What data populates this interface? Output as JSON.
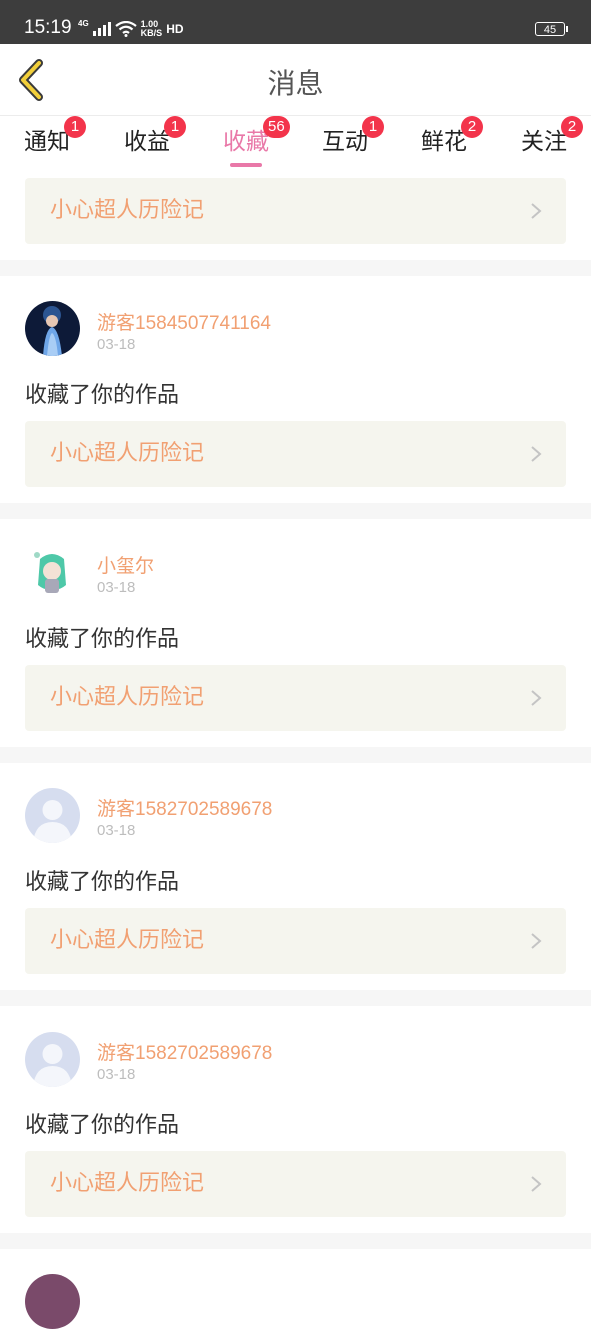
{
  "status_bar": {
    "time": "15:19",
    "network": "4G",
    "speed_value": "1.00",
    "speed_unit": "KB/S",
    "hd": "HD",
    "battery": "45"
  },
  "header": {
    "title": "消息",
    "back_icon": "chevron-left-icon"
  },
  "tabs": [
    {
      "label": "通知",
      "badge": "1",
      "active": false
    },
    {
      "label": "收益",
      "badge": "1",
      "active": false
    },
    {
      "label": "收藏",
      "badge": "56",
      "active": true
    },
    {
      "label": "互动",
      "badge": "1",
      "active": false
    },
    {
      "label": "鲜花",
      "badge": "2",
      "active": false
    },
    {
      "label": "关注",
      "badge": "2",
      "active": false
    }
  ],
  "colors": {
    "accent": "#e978a8",
    "badge": "#f3344b",
    "username": "#f1a072",
    "card_bg": "#f5f5ee"
  },
  "top_card": {
    "work_title": "小心超人历险记"
  },
  "items": [
    {
      "user": "游客1584507741164",
      "date": "03-18",
      "action": "收藏了你的作品",
      "work_title": "小心超人历险记",
      "avatar": "photo-avatar"
    },
    {
      "user": "小玺尔",
      "date": "03-18",
      "action": "收藏了你的作品",
      "work_title": "小心超人历险记",
      "avatar": "anime-avatar"
    },
    {
      "user": "游客1582702589678",
      "date": "03-18",
      "action": "收藏了你的作品",
      "work_title": "小心超人历险记",
      "avatar": "default-avatar"
    },
    {
      "user": "游客1582702589678",
      "date": "03-18",
      "action": "收藏了你的作品",
      "work_title": "小心超人历险记",
      "avatar": "default-avatar"
    }
  ]
}
